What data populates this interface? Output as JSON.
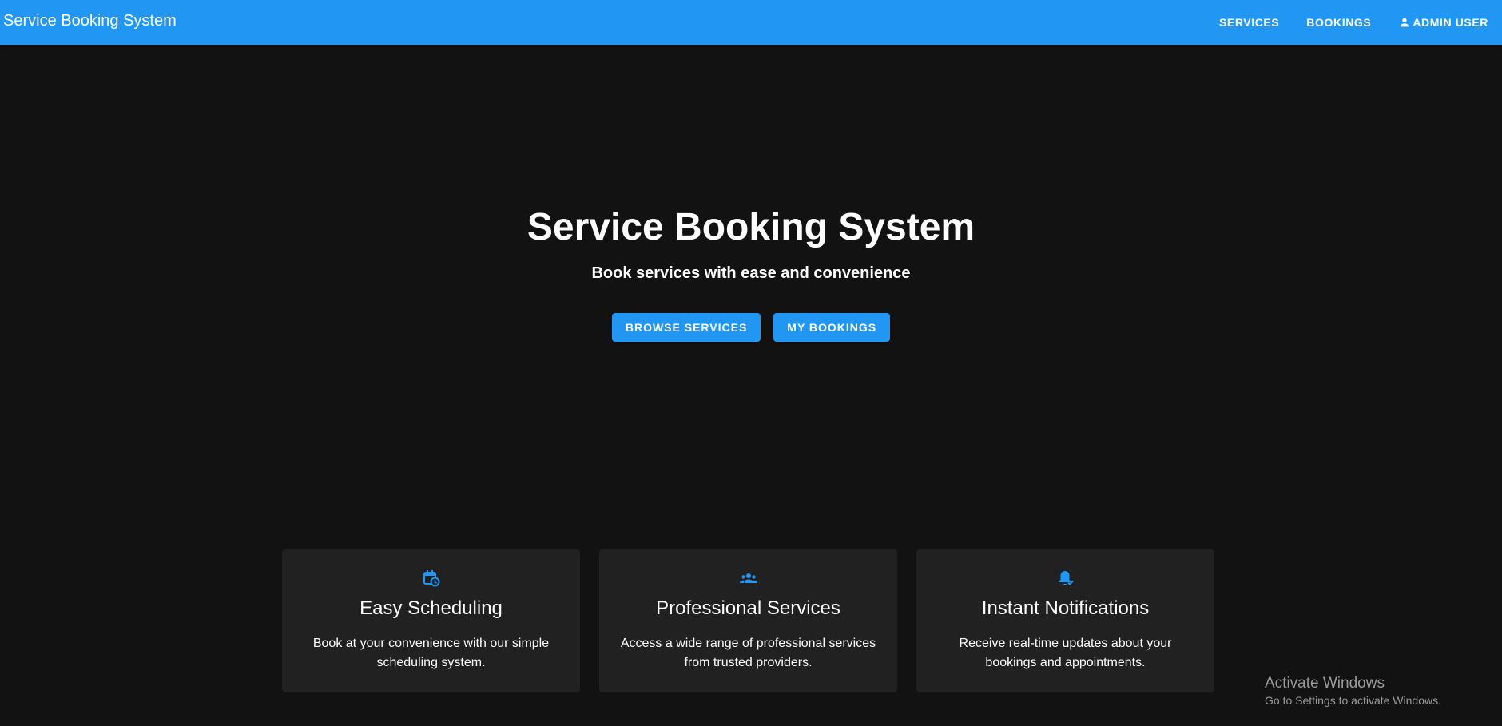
{
  "appbar": {
    "brand": "Service Booking System",
    "nav": [
      {
        "label": "SERVICES",
        "icon": ""
      },
      {
        "label": "BOOKINGS",
        "icon": ""
      },
      {
        "label": "ADMIN USER",
        "icon": "person-icon"
      }
    ],
    "color": "#2196f3"
  },
  "hero": {
    "title": "Service Booking System",
    "subtitle": "Book services with ease and convenience",
    "buttons": [
      "BROWSE SERVICES",
      "MY BOOKINGS"
    ]
  },
  "features": [
    {
      "icon": "calendar-clock-icon",
      "title": "Easy Scheduling",
      "text": "Book at your convenience with our simple scheduling system."
    },
    {
      "icon": "group-icon",
      "title": "Professional Services",
      "text": "Access a wide range of professional services from trusted providers."
    },
    {
      "icon": "notification-check-icon",
      "title": "Instant Notifications",
      "text": "Receive real-time updates about your bookings and appointments."
    }
  ],
  "watermark": {
    "title": "Activate Windows",
    "subtitle": "Go to Settings to activate Windows."
  },
  "colors": {
    "background": "#121212",
    "card": "#212121",
    "accent": "#2196f3"
  }
}
